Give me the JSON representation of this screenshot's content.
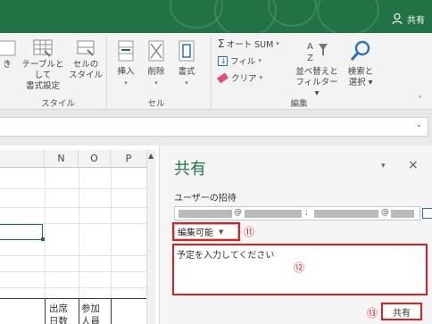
{
  "titlebar": {
    "share_label": "共有"
  },
  "ribbon": {
    "styles_group": {
      "conditional_label_1": "き",
      "conditional_label_2": "",
      "table_label_1": "テーブルとして",
      "table_label_2": "書式設定",
      "cell_style_label_1": "セルの",
      "cell_style_label_2": "スタイル",
      "group_label": "スタイル"
    },
    "cells_group": {
      "insert_label": "挿入",
      "delete_label": "削除",
      "format_label": "書式",
      "group_label": "セル"
    },
    "editing_group": {
      "autosum_label": "オート SUM",
      "fill_label": "フィル",
      "clear_label": "クリア",
      "sort_label_1": "並べ替えと",
      "sort_label_2": "フィルター",
      "find_label_1": "検索と",
      "find_label_2": "選択",
      "group_label": "編集"
    }
  },
  "sheet": {
    "columns": [
      "N",
      "O",
      "P"
    ],
    "cells": {
      "c1": "出席",
      "c2": "参加",
      "c3": "日数",
      "c4": "人員"
    }
  },
  "share_pane": {
    "title": "共有",
    "invite_label": "ユーザーの招待",
    "at_1": "@",
    "semicolon": ";",
    "at_2": "@",
    "permission_value": "編集可能",
    "message_placeholder": "予定を入力してください",
    "share_button": "共有",
    "marker_11": "⑪",
    "marker_12": "⑫",
    "marker_13": "⑬"
  },
  "colors": {
    "brand": "#217346",
    "annotation": "#e02020"
  }
}
